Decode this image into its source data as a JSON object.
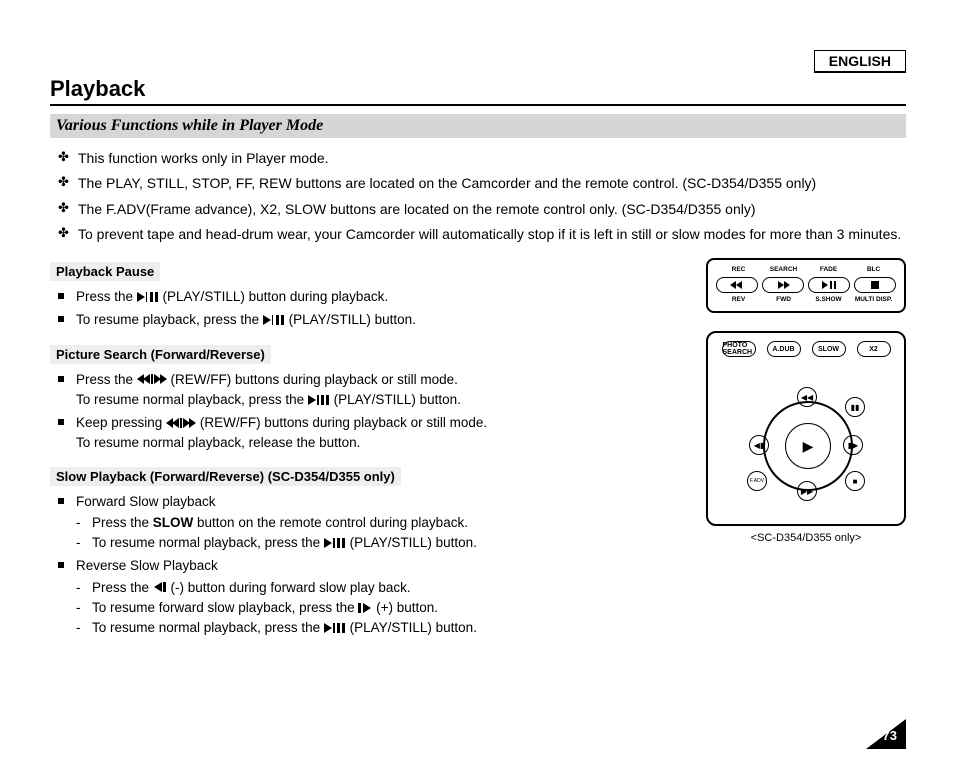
{
  "header": {
    "language": "ENGLISH",
    "title": "Playback"
  },
  "section": {
    "heading": "Various Functions while in Player Mode"
  },
  "intro": [
    "This function works only in Player mode.",
    "The PLAY, STILL, STOP, FF, REW buttons are located on the Camcorder and the remote control. (SC-D354/D355 only)",
    "The F.ADV(Frame advance), X2, SLOW buttons are located on the remote control only. (SC-D354/D355 only)",
    "To prevent tape and head-drum wear, your Camcorder will automatically stop if it is left in still or slow modes for more than 3 minutes."
  ],
  "playback_pause": {
    "heading": "Playback Pause",
    "items": [
      {
        "pre": "Press the ",
        "post": "(PLAY/STILL) button during playback."
      },
      {
        "pre": "To resume playback, press the ",
        "post": "(PLAY/STILL) button."
      }
    ]
  },
  "picture_search": {
    "heading": "Picture Search (Forward/Reverse)",
    "items": [
      {
        "l1pre": "Press the ",
        "l1post": "(REW/FF) buttons during playback or still mode.",
        "l2pre": "To resume normal playback, press the ",
        "l2post": "(PLAY/STILL) button."
      },
      {
        "l1pre": "Keep pressing ",
        "l1post": "(REW/FF) buttons during playback or still mode.",
        "l2": "To resume normal playback, release the button."
      }
    ]
  },
  "slow_playback": {
    "heading": "Slow Playback (Forward/Reverse) (SC-D354/D355 only)",
    "fwd_label": "Forward Slow playback",
    "fwd": [
      {
        "pre": "Press the ",
        "bold": "SLOW",
        "post": " button on the remote control during playback."
      },
      {
        "pre": "To resume normal playback, press the ",
        "post": "(PLAY/STILL) button."
      }
    ],
    "rev_label": "Reverse Slow Playback",
    "rev": [
      {
        "pre": "Press the ",
        "post": "(-) button during forward slow play back."
      },
      {
        "pre": "To resume forward slow playback, press the ",
        "post": "(+) button."
      },
      {
        "pre": "To resume normal playback, press the ",
        "post": "(PLAY/STILL) button."
      }
    ]
  },
  "panel": {
    "row1": [
      "REC",
      "SEARCH",
      "FADE",
      "BLC"
    ],
    "row2": [
      "REV",
      "FWD",
      "S.SHOW",
      "MULTI DISP."
    ]
  },
  "remote": {
    "row_labels": [
      "PHOTO SEARCH",
      "A.DUB",
      "SLOW",
      "X2"
    ],
    "fadv_label": "F.ADV",
    "caption": "<SC-D354/D355 only>"
  },
  "page_number": "73"
}
